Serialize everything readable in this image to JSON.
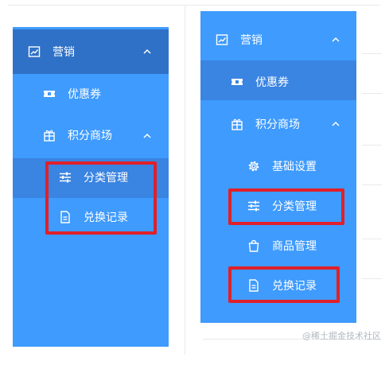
{
  "left": {
    "menu": {
      "marketing": "营销",
      "coupons": "优惠券",
      "points_mall": "积分商场",
      "category_mgmt": "分类管理",
      "exchange_records": "兑换记录"
    }
  },
  "right": {
    "menu": {
      "marketing": "营销",
      "coupons": "优惠券",
      "points_mall": "积分商场",
      "basic_settings": "基础设置",
      "category_mgmt": "分类管理",
      "product_mgmt": "商品管理",
      "exchange_records": "兑换记录"
    }
  },
  "watermark": "@稀土掘金技术社区",
  "colors": {
    "menu_bg": "#3f9bfe",
    "header_active_bg": "#2f71c7",
    "selected_item_bg": "#3a84e2",
    "highlight_border": "#e0202a",
    "text": "#ffffff"
  }
}
